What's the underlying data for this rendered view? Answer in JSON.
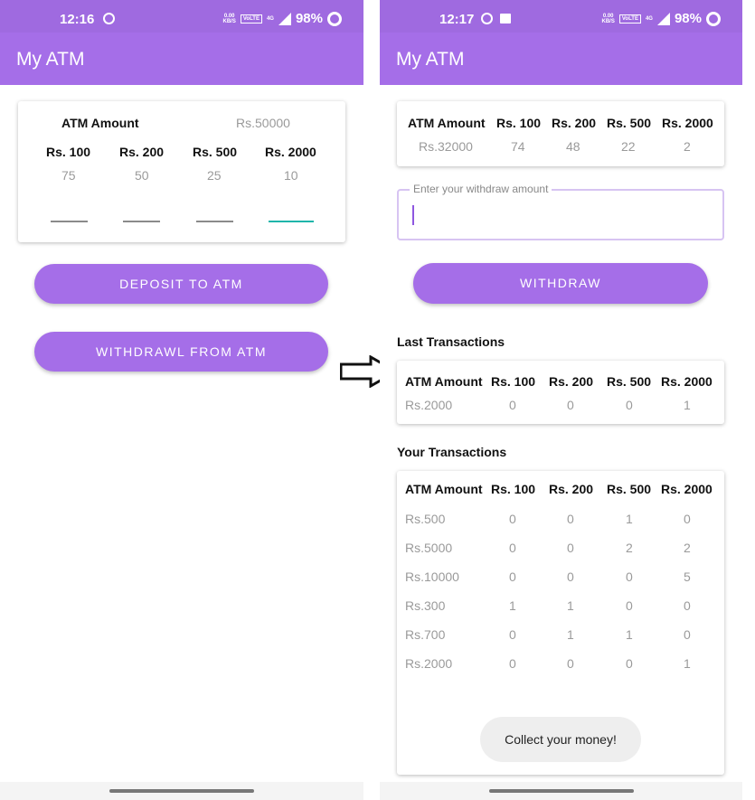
{
  "left": {
    "status": {
      "time": "12:16",
      "net_speed_top": "0.00",
      "net_speed_bottom": "KB/S",
      "volte": "VoLTE",
      "net_type": "4G",
      "battery": "98%"
    },
    "app_title": "My ATM",
    "atm_card": {
      "label": "ATM Amount",
      "amount": "Rs.50000",
      "denoms": [
        {
          "label": "Rs. 100",
          "count": "75"
        },
        {
          "label": "Rs. 200",
          "count": "50"
        },
        {
          "label": "Rs. 500",
          "count": "25"
        },
        {
          "label": "Rs. 2000",
          "count": "10"
        }
      ]
    },
    "deposit_button": "DEPOSIT TO ATM",
    "withdraw_button": "WITHDRAWL FROM ATM"
  },
  "right": {
    "status": {
      "time": "12:17",
      "net_speed_top": "0.00",
      "net_speed_bottom": "KB/S",
      "volte": "VoLTE",
      "net_type": "4G",
      "battery": "98%"
    },
    "app_title": "My ATM",
    "atm_table": {
      "headers": [
        "ATM Amount",
        "Rs. 100",
        "Rs. 200",
        "Rs. 500",
        "Rs. 2000"
      ],
      "row": [
        "Rs.32000",
        "74",
        "48",
        "22",
        "2"
      ]
    },
    "withdraw_field": {
      "label": "Enter your withdraw amount",
      "value": ""
    },
    "withdraw_button": "WITHDRAW",
    "last_title": "Last Transactions",
    "last_table": {
      "headers": [
        "ATM Amount",
        "Rs. 100",
        "Rs. 200",
        "Rs. 500",
        "Rs. 2000"
      ],
      "row": [
        "Rs.2000",
        "0",
        "0",
        "0",
        "1"
      ]
    },
    "your_title": "Your Transactions",
    "your_table": {
      "headers": [
        "ATM Amount",
        "Rs. 100",
        "Rs. 200",
        "Rs. 500",
        "Rs. 2000"
      ],
      "rows": [
        [
          "Rs.500",
          "0",
          "0",
          "1",
          "0"
        ],
        [
          "Rs.5000",
          "0",
          "0",
          "2",
          "2"
        ],
        [
          "Rs.10000",
          "0",
          "0",
          "0",
          "5"
        ],
        [
          "Rs.300",
          "1",
          "1",
          "0",
          "0"
        ],
        [
          "Rs.700",
          "0",
          "1",
          "1",
          "0"
        ],
        [
          "Rs.2000",
          "0",
          "0",
          "0",
          "1"
        ]
      ]
    },
    "toast": "Collect your money!"
  },
  "colors": {
    "primary": "#a56ee8",
    "status_bar": "#9f6ae0",
    "accent": "#1fb5aa",
    "muted_text": "#9a9a9a"
  }
}
